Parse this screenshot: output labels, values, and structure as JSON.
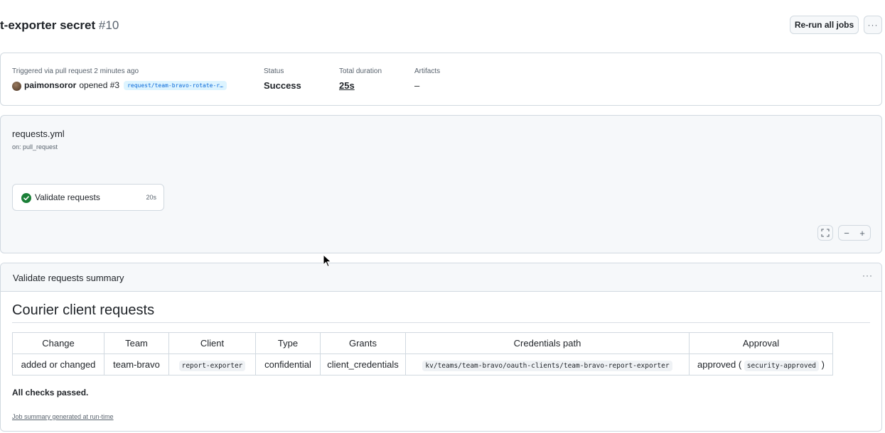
{
  "header": {
    "title": "t-exporter secret",
    "run_number": "#10",
    "rerun_label": "Re-run all jobs",
    "more_label": "···"
  },
  "run_summary": {
    "trigger_label": "Triggered via pull request 2 minutes ago",
    "actor": "paimonsoror",
    "action_text": "opened #3",
    "branch": "request/team-bravo-rotate-r…",
    "status_label": "Status",
    "status_value": "Success",
    "duration_label": "Total duration",
    "duration_value": "25s",
    "artifacts_label": "Artifacts",
    "artifacts_value": "–"
  },
  "workflow": {
    "file": "requests.yml",
    "on": "on: pull_request",
    "job": {
      "name": "Validate requests",
      "duration": "20s",
      "status": "success"
    },
    "controls": {
      "zoom_out": "−",
      "zoom_in": "+"
    }
  },
  "job_summary": {
    "title": "Validate requests summary",
    "more_label": "···",
    "heading": "Courier client requests",
    "table": {
      "headers": [
        "Change",
        "Team",
        "Client",
        "Type",
        "Grants",
        "Credentials path",
        "Approval"
      ],
      "rows": [
        {
          "change": "added or changed",
          "team": "team-bravo",
          "client": "report-exporter",
          "type": "confidential",
          "grants": "client_credentials",
          "path": "kv/teams/team-bravo/oauth-clients/team-bravo-report-exporter",
          "approval_text": "approved (",
          "approval_code": "security-approved",
          "approval_close": ")"
        }
      ]
    },
    "checks_text": "All checks passed.",
    "generated_text": "Job summary generated at run-time"
  },
  "colors": {
    "success": "#1a7f37",
    "link": "#0969da",
    "muted": "#59636e",
    "border": "#d1d9e0"
  }
}
